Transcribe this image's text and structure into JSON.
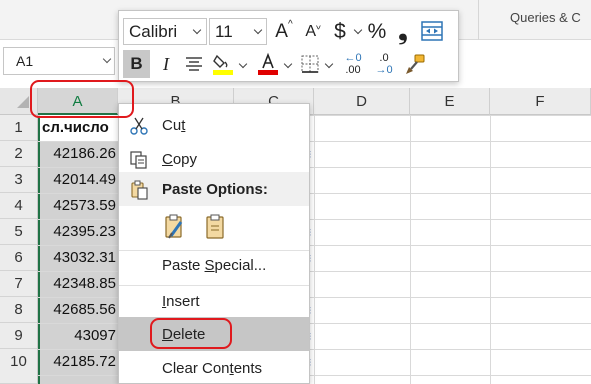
{
  "ribbon": {
    "queries_label": "Queries & C"
  },
  "name_box": {
    "value": "A1"
  },
  "columns": [
    "A",
    "B",
    "C",
    "D",
    "E",
    "F"
  ],
  "selected_column": "A",
  "rows": [
    {
      "num": "1",
      "a": "сл.число"
    },
    {
      "num": "2",
      "a": "42186.26"
    },
    {
      "num": "3",
      "a": "42014.49"
    },
    {
      "num": "4",
      "a": "42573.59"
    },
    {
      "num": "5",
      "a": "42395.23"
    },
    {
      "num": "6",
      "a": "43032.31"
    },
    {
      "num": "7",
      "a": "42348.85"
    },
    {
      "num": "8",
      "a": "42685.56"
    },
    {
      "num": "9",
      "a": "43097"
    },
    {
      "num": "10",
      "a": "42185.72"
    }
  ],
  "mini_toolbar": {
    "font_name": "Calibri",
    "font_size": "11",
    "grow_font": "A",
    "shrink_font": "A",
    "currency": "$",
    "percent": "%",
    "comma": "❟",
    "bold": "B",
    "italic": "I",
    "dec_increase": ".00",
    "dec_decrease": ".0",
    "font_color": "#e00000",
    "highlight_color": "#ffff00"
  },
  "context_menu": {
    "cut": "Cut",
    "copy": "Copy",
    "paste_options": "Paste Options:",
    "paste_special": "Paste Special...",
    "insert": "Insert",
    "delete": "Delete",
    "clear_contents": "Clear Contents"
  },
  "colors": {
    "accent_green": "#217346",
    "annotation_red": "#e0191d",
    "selection_gray": "#d2d2d2"
  }
}
